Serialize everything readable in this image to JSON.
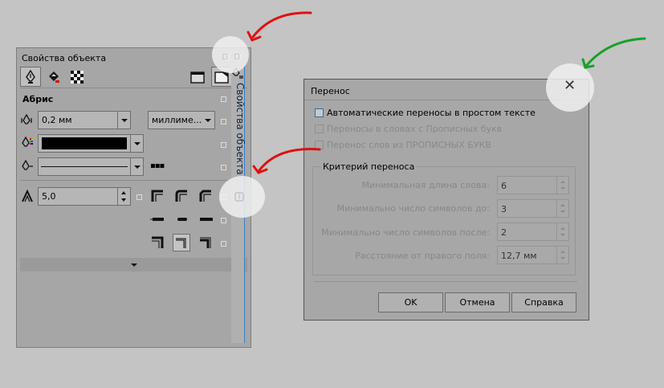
{
  "panel": {
    "title": "Свойства объекта",
    "vertical_tab_label": "Свойства объекта",
    "section_title": "Абрис",
    "width_value": "0,2 мм",
    "units_value": "миллиме...",
    "line_style_dots": "▪▪▪",
    "miter_value": "5,0"
  },
  "dialog": {
    "title": "Перенос",
    "close_glyph": "✕",
    "options": [
      {
        "label": "Автоматические переносы в простом тексте",
        "enabled": true
      },
      {
        "label": "Переносы в словах с Прописных букв",
        "enabled": false
      },
      {
        "label": "Перенос слов из ПРОПИСНЫХ БУКВ",
        "enabled": false
      }
    ],
    "group_title": "Критерий переноса",
    "fields": [
      {
        "label": "Минимальная длина слова:",
        "value": "6"
      },
      {
        "label": "Минимально число символов до:",
        "value": "3"
      },
      {
        "label": "Минимально число символов после:",
        "value": "2"
      },
      {
        "label": "Расстояние от правого поля:",
        "value": "12,7 мм"
      }
    ],
    "buttons": {
      "ok": "OK",
      "cancel": "Отмена",
      "help": "Справка"
    }
  },
  "colors": {
    "background": "#c4c4c4",
    "panel": "#a6a6a6",
    "arrow_red": "#e01010",
    "arrow_green": "#16a02a",
    "accent_blue": "#3a7ec6"
  }
}
